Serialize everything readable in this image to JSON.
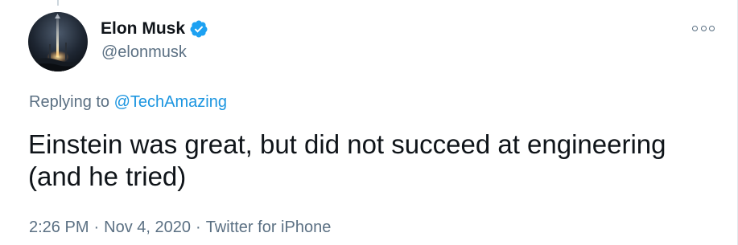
{
  "tweet": {
    "author": {
      "display_name": "Elon Musk",
      "handle": "@elonmusk",
      "verified": true
    },
    "reply_prefix": "Replying to",
    "reply_to": "@TechAmazing",
    "text": "Einstein was great, but did not succeed at engineering (and he tried)",
    "time": "2:26 PM",
    "separator": "·",
    "date": "Nov 4, 2020",
    "source": "Twitter for iPhone"
  },
  "icons": {
    "verified": "verified-badge-icon",
    "more": "more-options-icon"
  },
  "colors": {
    "accent": "#1da1f2",
    "mention": "#1b95e0",
    "secondary_text": "#5b7083",
    "primary_text": "#0f1419"
  }
}
